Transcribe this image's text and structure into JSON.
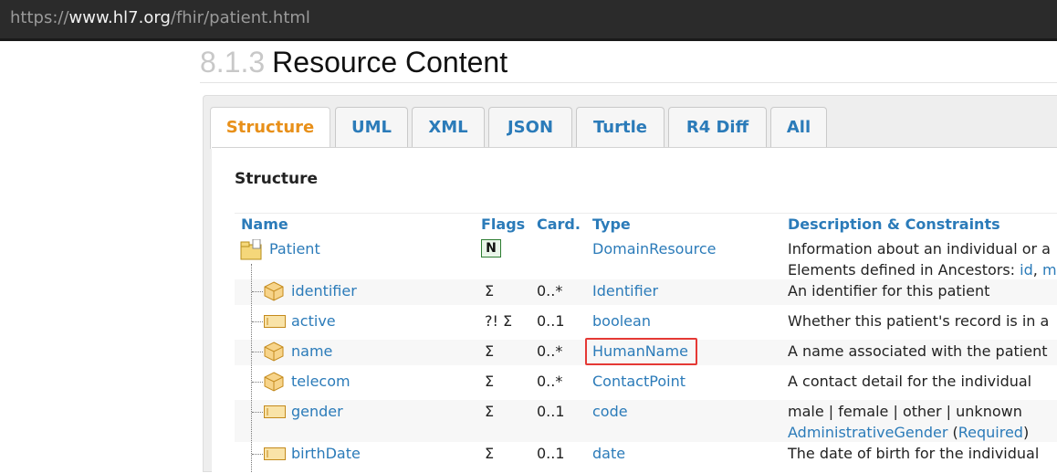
{
  "browser": {
    "url_scheme": "https://",
    "url_host": "www.hl7.org",
    "url_path": "/fhir/patient.html"
  },
  "section": {
    "number": "8.1.3",
    "title": "Resource Content"
  },
  "tabs": [
    {
      "label": "Structure",
      "active": true
    },
    {
      "label": "UML",
      "active": false
    },
    {
      "label": "XML",
      "active": false
    },
    {
      "label": "JSON",
      "active": false
    },
    {
      "label": "Turtle",
      "active": false
    },
    {
      "label": "R4 Diff",
      "active": false
    },
    {
      "label": "All",
      "active": false
    }
  ],
  "structure_title": "Structure",
  "columns": {
    "name": "Name",
    "flags": "Flags",
    "card": "Card.",
    "type": "Type",
    "desc": "Description & Constraints"
  },
  "rows": [
    {
      "name": "Patient",
      "icon": "folder-icon",
      "flags": "N",
      "card": "",
      "type": "DomainResource",
      "desc": "Information about an individual or a",
      "desc2_prefix": "Elements defined in Ancestors: ",
      "desc2_link": "id",
      "desc2_sep": ", ",
      "desc2_trail": "m"
    },
    {
      "name": "identifier",
      "icon": "cube-icon",
      "flags": "Σ",
      "card": "0..*",
      "type": "Identifier",
      "desc": "An identifier for this patient"
    },
    {
      "name": "active",
      "icon": "primitive-icon",
      "flags": "?! Σ",
      "card": "0..1",
      "type": "boolean",
      "desc": "Whether this patient's record is in a"
    },
    {
      "name": "name",
      "icon": "cube-icon",
      "flags": "Σ",
      "card": "0..*",
      "type": "HumanName",
      "desc": "A name associated with the patient",
      "highlighted": true
    },
    {
      "name": "telecom",
      "icon": "cube-icon",
      "flags": "Σ",
      "card": "0..*",
      "type": "ContactPoint",
      "desc": "A contact detail for the individual"
    },
    {
      "name": "gender",
      "icon": "primitive-icon",
      "flags": "Σ",
      "card": "0..1",
      "type": "code",
      "desc": "male | female | other | unknown",
      "desc2_link": "AdministrativeGender",
      "desc2_open": " (",
      "desc2_link2": "Required",
      "desc2_close": ")"
    },
    {
      "name": "birthDate",
      "icon": "primitive-icon",
      "flags": "Σ",
      "card": "0..1",
      "type": "date",
      "desc": "The date of birth for the individual"
    }
  ],
  "colors": {
    "link": "#2b7bb9",
    "active_tab": "#e8901a",
    "highlight": "#e53935"
  }
}
